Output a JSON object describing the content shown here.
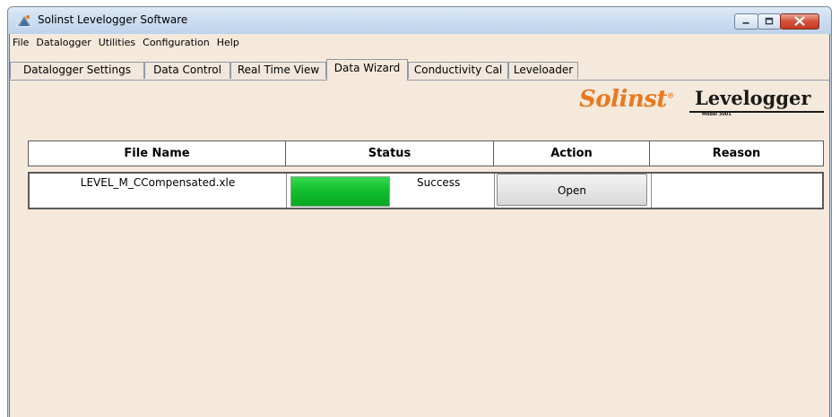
{
  "window": {
    "title": "Solinst Levelogger Software"
  },
  "menu": [
    "File",
    "Datalogger",
    "Utilities",
    "Configuration",
    "Help"
  ],
  "tabs": [
    {
      "label": "Datalogger Settings",
      "active": false
    },
    {
      "label": "Data Control",
      "active": false
    },
    {
      "label": "Real Time View",
      "active": false
    },
    {
      "label": "Data Wizard",
      "active": true
    },
    {
      "label": "Conductivity Cal",
      "active": false
    },
    {
      "label": "Leveloader",
      "active": false
    }
  ],
  "logos": {
    "solinst": "Solinst",
    "levelogger": "Levelogger",
    "model": "Model 3001"
  },
  "table": {
    "headers": [
      "File Name",
      "Status",
      "Action",
      "Reason"
    ],
    "rows": [
      {
        "file_name": "LEVEL_M_CCompensated.xle",
        "progress": 1.0,
        "status": "Success",
        "action": "Open",
        "reason": ""
      }
    ]
  },
  "colors": {
    "client_background": "#f5e9dc",
    "progress_green": "#12c02e",
    "solinst_orange": "#e8791f"
  }
}
